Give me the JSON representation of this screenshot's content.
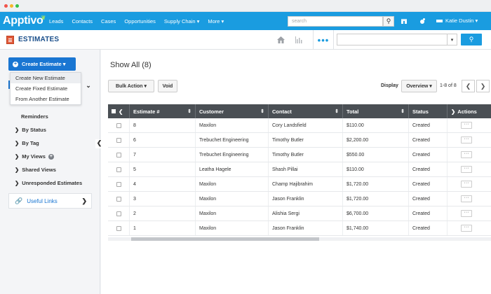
{
  "app": {
    "logo": "Apptivo",
    "module_title": "ESTIMATES"
  },
  "topnav": {
    "items": [
      "Leads",
      "Contacts",
      "Cases",
      "Opportunities",
      "Supply Chain ▾",
      "More ▾"
    ],
    "search_placeholder": "search",
    "user": "Katie Dustin ▾"
  },
  "sidebar": {
    "create_button": "Create Estimate ▾",
    "dropdown": [
      "Create New Estimate",
      "Create Fixed Estimate",
      "From Another Estimate"
    ],
    "items": [
      "Reminders",
      "By Status",
      "By Tag",
      "My Views",
      "Shared Views",
      "Unresponded Estimates"
    ],
    "useful_links": "Useful Links"
  },
  "main": {
    "heading": "Show All (8)",
    "bulk_action": "Bulk Action ▾",
    "void": "Void",
    "display_label": "Display",
    "display_value": "Overview ▾",
    "paging": "1-8 of 8"
  },
  "table": {
    "headers": [
      "Estimate #",
      "Customer",
      "Contact",
      "Total",
      "Status",
      "Actions"
    ],
    "rows": [
      [
        "8",
        "Maxilon",
        "Cory Landsfield",
        "$110.00",
        "Created"
      ],
      [
        "6",
        "Trebuchet Engineering",
        "Timothy Butler",
        "$2,200.00",
        "Created"
      ],
      [
        "7",
        "Trebuchet Engineering",
        "Timothy Butler",
        "$550.00",
        "Created"
      ],
      [
        "5",
        "Leatha Hagele",
        "Shash Pillai",
        "$110.00",
        "Created"
      ],
      [
        "4",
        "Maxilon",
        "Champ Hajibrahim",
        "$1,720.00",
        "Created"
      ],
      [
        "3",
        "Maxilon",
        "Jason Franklin",
        "$1,720.00",
        "Created"
      ],
      [
        "2",
        "Maxilon",
        "Alishia Sergi",
        "$6,700.00",
        "Created"
      ],
      [
        "1",
        "Maxilon",
        "Jason Franklin",
        "$1,740.00",
        "Created"
      ]
    ],
    "action_glyph": "···"
  },
  "colors": {
    "brand": "#1a9ce0",
    "primary_button": "#1a76d2",
    "table_header": "#4a4f54"
  }
}
